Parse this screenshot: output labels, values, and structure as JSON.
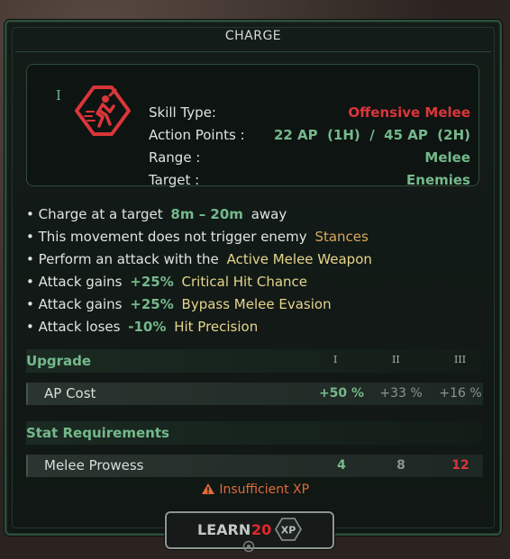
{
  "title": "CHARGE",
  "info": {
    "roman_mark": "I",
    "rows": [
      {
        "label": "Skill Type:",
        "value": "Offensive Melee"
      },
      {
        "label": "Action Points :",
        "value": "22 AP  (1H)  /  45 AP  (2H)"
      },
      {
        "label": "Range :",
        "value": "Melee"
      },
      {
        "label": "Target :",
        "value": "Enemies"
      }
    ]
  },
  "bullets": [
    {
      "pre": "• Charge at a target",
      "hl": "8m – 20m",
      "post": "away"
    },
    {
      "pre": "• This movement does not trigger enemy",
      "hl": "Stances",
      "post": ""
    },
    {
      "pre": "• Perform an attack with the",
      "hl": "Active Melee Weapon",
      "post": ""
    },
    {
      "pre": "• Attack gains",
      "num": "+25%",
      "hl": "Critical Hit Chance"
    },
    {
      "pre": "• Attack gains",
      "num": "+25%",
      "hl": "Bypass Melee Evasion"
    },
    {
      "pre": "• Attack loses",
      "num": "-10%",
      "hl": "Hit Precision"
    }
  ],
  "upgrade": {
    "header": "Upgrade",
    "columns": [
      "I",
      "II",
      "III"
    ],
    "row_label": "AP Cost",
    "values": [
      "+50 %",
      "+33 %",
      "+16 %"
    ]
  },
  "requirements": {
    "header": "Stat Requirements",
    "row_label": "Melee Prowess",
    "values": [
      "4",
      "8",
      "12"
    ]
  },
  "warning": "Insufficient XP",
  "learn": {
    "label": "LEARN",
    "cost": "20",
    "currency": "XP"
  },
  "colors": {
    "accent_green": "#74b98c",
    "accent_red": "#d9363b",
    "highlight_yellow": "#e7d58a",
    "warning_orange": "#e06a3a"
  },
  "icons": {
    "skill": "charge-runner-icon",
    "warning": "warning-triangle-icon",
    "currency": "xp-hexagon-icon"
  }
}
